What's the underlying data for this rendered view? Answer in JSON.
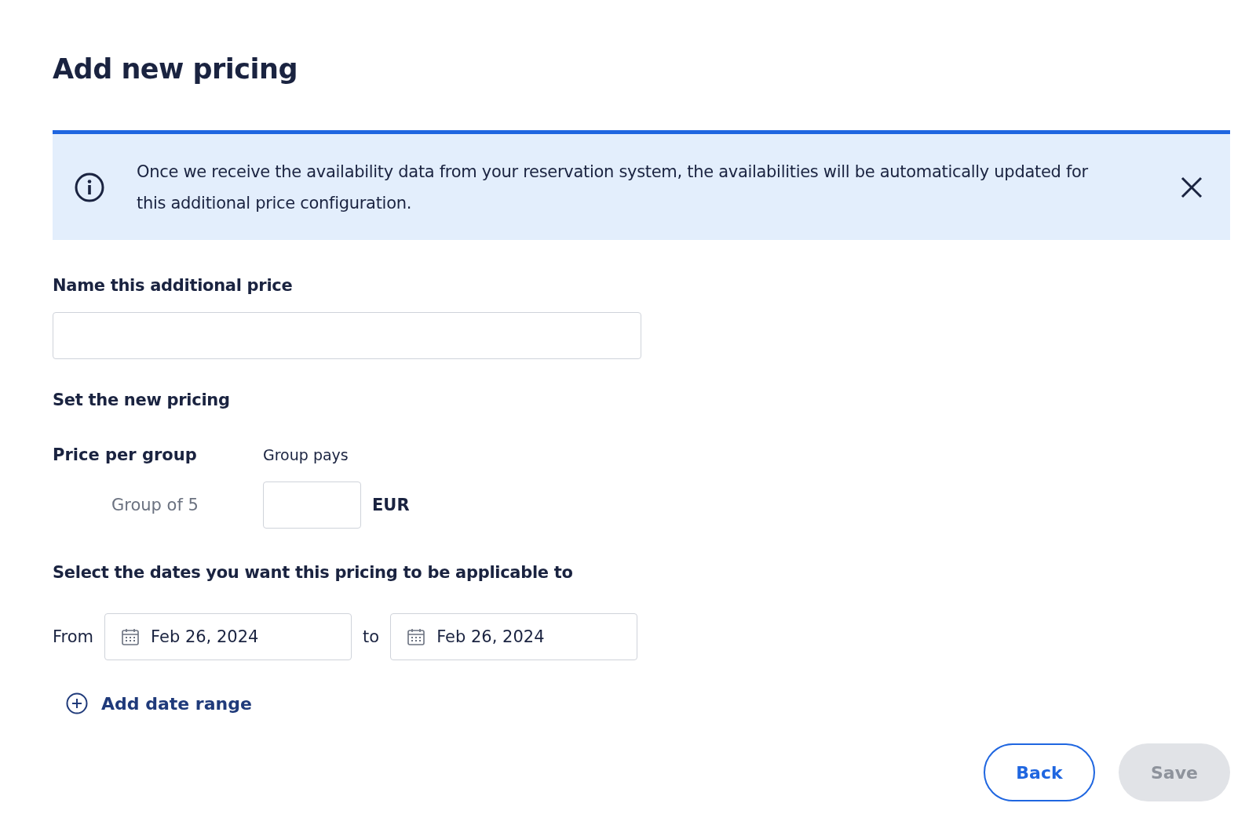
{
  "title": "Add new pricing",
  "banner": {
    "text": "Once we receive the availability data from your reservation system, the availabilities will be automatically updated for this additional price configuration."
  },
  "name_field": {
    "label": "Name this additional price"
  },
  "pricing": {
    "heading": "Set the new pricing",
    "label": "Price per group",
    "column_label": "Group pays",
    "rows": [
      {
        "group": "Group of 5",
        "currency": "EUR"
      }
    ]
  },
  "dates": {
    "heading": "Select the dates you want this pricing to be applicable to",
    "from_label": "From",
    "from": "Feb 26, 2024",
    "to_label": "to",
    "to": "Feb 26, 2024"
  },
  "add_range": "Add date range",
  "buttons": [
    {
      "label": "Back",
      "disabled": false
    },
    {
      "label": "Save",
      "disabled": true
    }
  ]
}
